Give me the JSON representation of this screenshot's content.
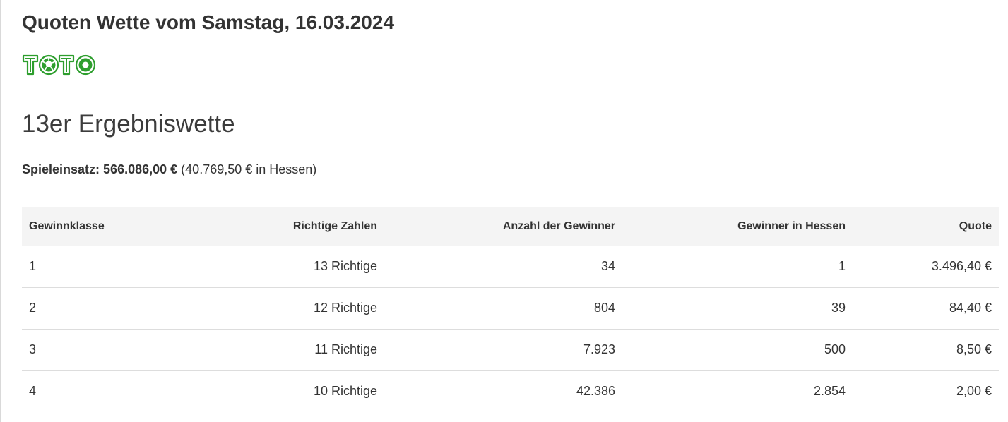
{
  "header": {
    "title": "Quoten Wette vom Samstag, 16.03.2024",
    "logo_text": "TOTO"
  },
  "section": {
    "title": "13er Ergebniswette"
  },
  "stake": {
    "label": "Spieleinsatz:",
    "amount": "566.086,00  €",
    "hessen": "(40.769,50  € in Hessen)"
  },
  "colors": {
    "logo_green": "#2e9e2e",
    "header_bg": "#f4f4f4",
    "text": "#333333"
  },
  "table": {
    "columns": [
      "Gewinnklasse",
      "Richtige Zahlen",
      "Anzahl der Gewinner",
      "Gewinner in Hessen",
      "Quote"
    ],
    "rows": [
      [
        "1",
        "13 Richtige",
        "34",
        "1",
        "3.496,40  €"
      ],
      [
        "2",
        "12 Richtige",
        "804",
        "39",
        "84,40  €"
      ],
      [
        "3",
        "11 Richtige",
        "7.923",
        "500",
        "8,50  €"
      ],
      [
        "4",
        "10 Richtige",
        "42.386",
        "2.854",
        "2,00  €"
      ]
    ]
  }
}
